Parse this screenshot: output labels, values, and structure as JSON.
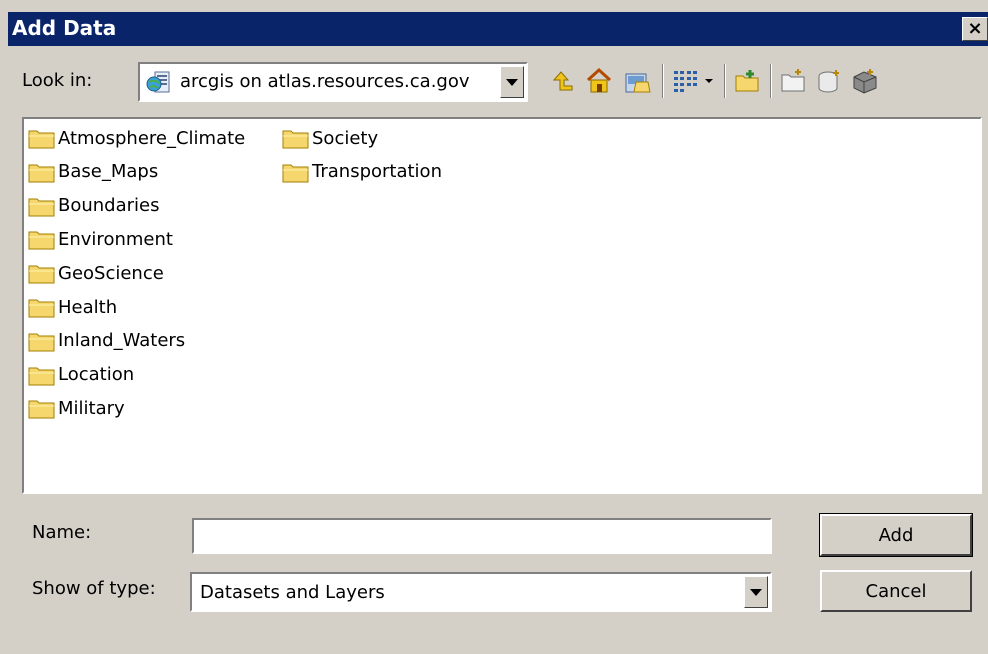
{
  "window": {
    "title": "Add Data",
    "close_label": "×"
  },
  "lookin": {
    "label": "Look in:",
    "value": "arcgis on atlas.resources.ca.gov"
  },
  "toolbar": {
    "icons": [
      "up-one-level-icon",
      "home-icon",
      "connect-to-folder-icon",
      "view-options-icon",
      "new-folder-icon",
      "new-item-icon",
      "new-file-geodatabase-icon",
      "catalog-icon"
    ]
  },
  "folders": {
    "column1": [
      "Atmosphere_Climate",
      "Base_Maps",
      "Boundaries",
      "Environment",
      "GeoScience",
      "Health",
      "Inland_Waters",
      "Location",
      "Military"
    ],
    "column2": [
      "Society",
      "Transportation"
    ]
  },
  "name": {
    "label": "Name:",
    "value": ""
  },
  "type": {
    "label": "Show of type:",
    "value": "Datasets and Layers"
  },
  "buttons": {
    "add": "Add",
    "cancel": "Cancel"
  },
  "colors": {
    "titlebar": "#0a246a",
    "folder_fill": "#f5d76e",
    "dialog_bg": "#d4d0c8"
  }
}
